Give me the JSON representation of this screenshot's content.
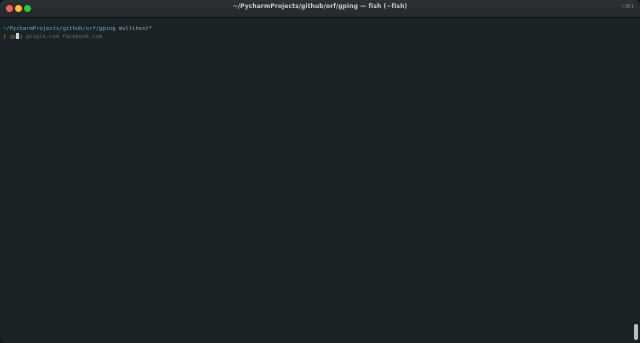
{
  "window": {
    "title": "~/PycharmProjects/github/orf/gping — fish (~fish)",
    "shortcut": "⌥⌘1",
    "traffic_lights": [
      "close",
      "minimize",
      "zoom"
    ]
  },
  "terminal": {
    "cwd": "~/PycharmProjects/github/orf/gping",
    "branch": " multihost*",
    "prompt_symbol": "❯",
    "typed_command": "gp",
    "autosuggestion": "g google.com facebook.com"
  },
  "colors": {
    "background": "#1b2326",
    "path": "#56b0c8",
    "prompt": "#e05561",
    "typed": "#6a7a36",
    "autosuggestion": "#5d6a6e"
  }
}
